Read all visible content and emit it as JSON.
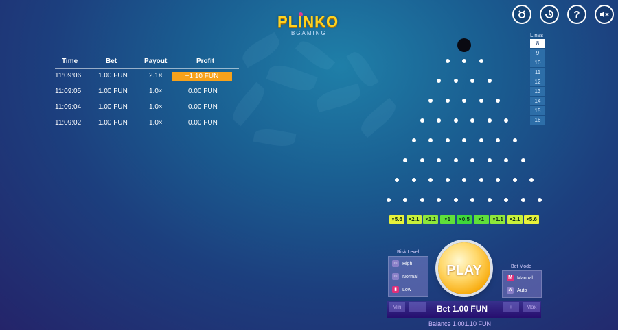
{
  "header": {
    "logo_title": "PLINKO",
    "logo_subtitle": "BGAMING",
    "buttons": [
      {
        "name": "lock-icon",
        "glyph": "☉"
      },
      {
        "name": "history-icon",
        "glyph": "↺"
      },
      {
        "name": "help-icon",
        "glyph": "?"
      },
      {
        "name": "mute-icon",
        "glyph": "🔇"
      }
    ]
  },
  "history": {
    "headers": {
      "time": "Time",
      "bet": "Bet",
      "payout": "Payout",
      "profit": "Profit"
    },
    "rows": [
      {
        "time": "11:09:06",
        "bet": "1.00 FUN",
        "payout": "2.1×",
        "profit": "+1.10 FUN",
        "win": true
      },
      {
        "time": "11:09:05",
        "bet": "1.00 FUN",
        "payout": "1.0×",
        "profit": "0.00 FUN",
        "win": false
      },
      {
        "time": "11:09:04",
        "bet": "1.00 FUN",
        "payout": "1.0×",
        "profit": "0.00 FUN",
        "win": false
      },
      {
        "time": "11:09:02",
        "bet": "1.00 FUN",
        "payout": "1.0×",
        "profit": "0.00 FUN",
        "win": false
      }
    ]
  },
  "lines": {
    "label": "Lines",
    "options": [
      "8",
      "9",
      "10",
      "11",
      "12",
      "13",
      "14",
      "15",
      "16"
    ],
    "selected": "8"
  },
  "multipliers": [
    {
      "label": "×5.6",
      "color": "#e8f23a"
    },
    {
      "label": "×2.1",
      "color": "#c8f03a"
    },
    {
      "label": "×1.1",
      "color": "#8fe83a"
    },
    {
      "label": "×1",
      "color": "#5fe03a"
    },
    {
      "label": "×0.5",
      "color": "#3fd83a"
    },
    {
      "label": "×1",
      "color": "#5fe03a"
    },
    {
      "label": "×1.1",
      "color": "#8fe83a"
    },
    {
      "label": "×2.1",
      "color": "#c8f03a"
    },
    {
      "label": "×5.6",
      "color": "#e8f23a"
    }
  ],
  "controls": {
    "risk_label": "Risk Level",
    "risk_high": "High",
    "risk_normal": "Normal",
    "risk_low": "Low",
    "mode_label": "Bet Mode",
    "mode_manual": "Manual",
    "mode_auto": "Auto",
    "play": "PLAY",
    "min": "Min",
    "minus": "−",
    "plus": "+",
    "max": "Max",
    "bet": "Bet 1.00 FUN",
    "balance": "Balance 1,001.10 FUN"
  }
}
